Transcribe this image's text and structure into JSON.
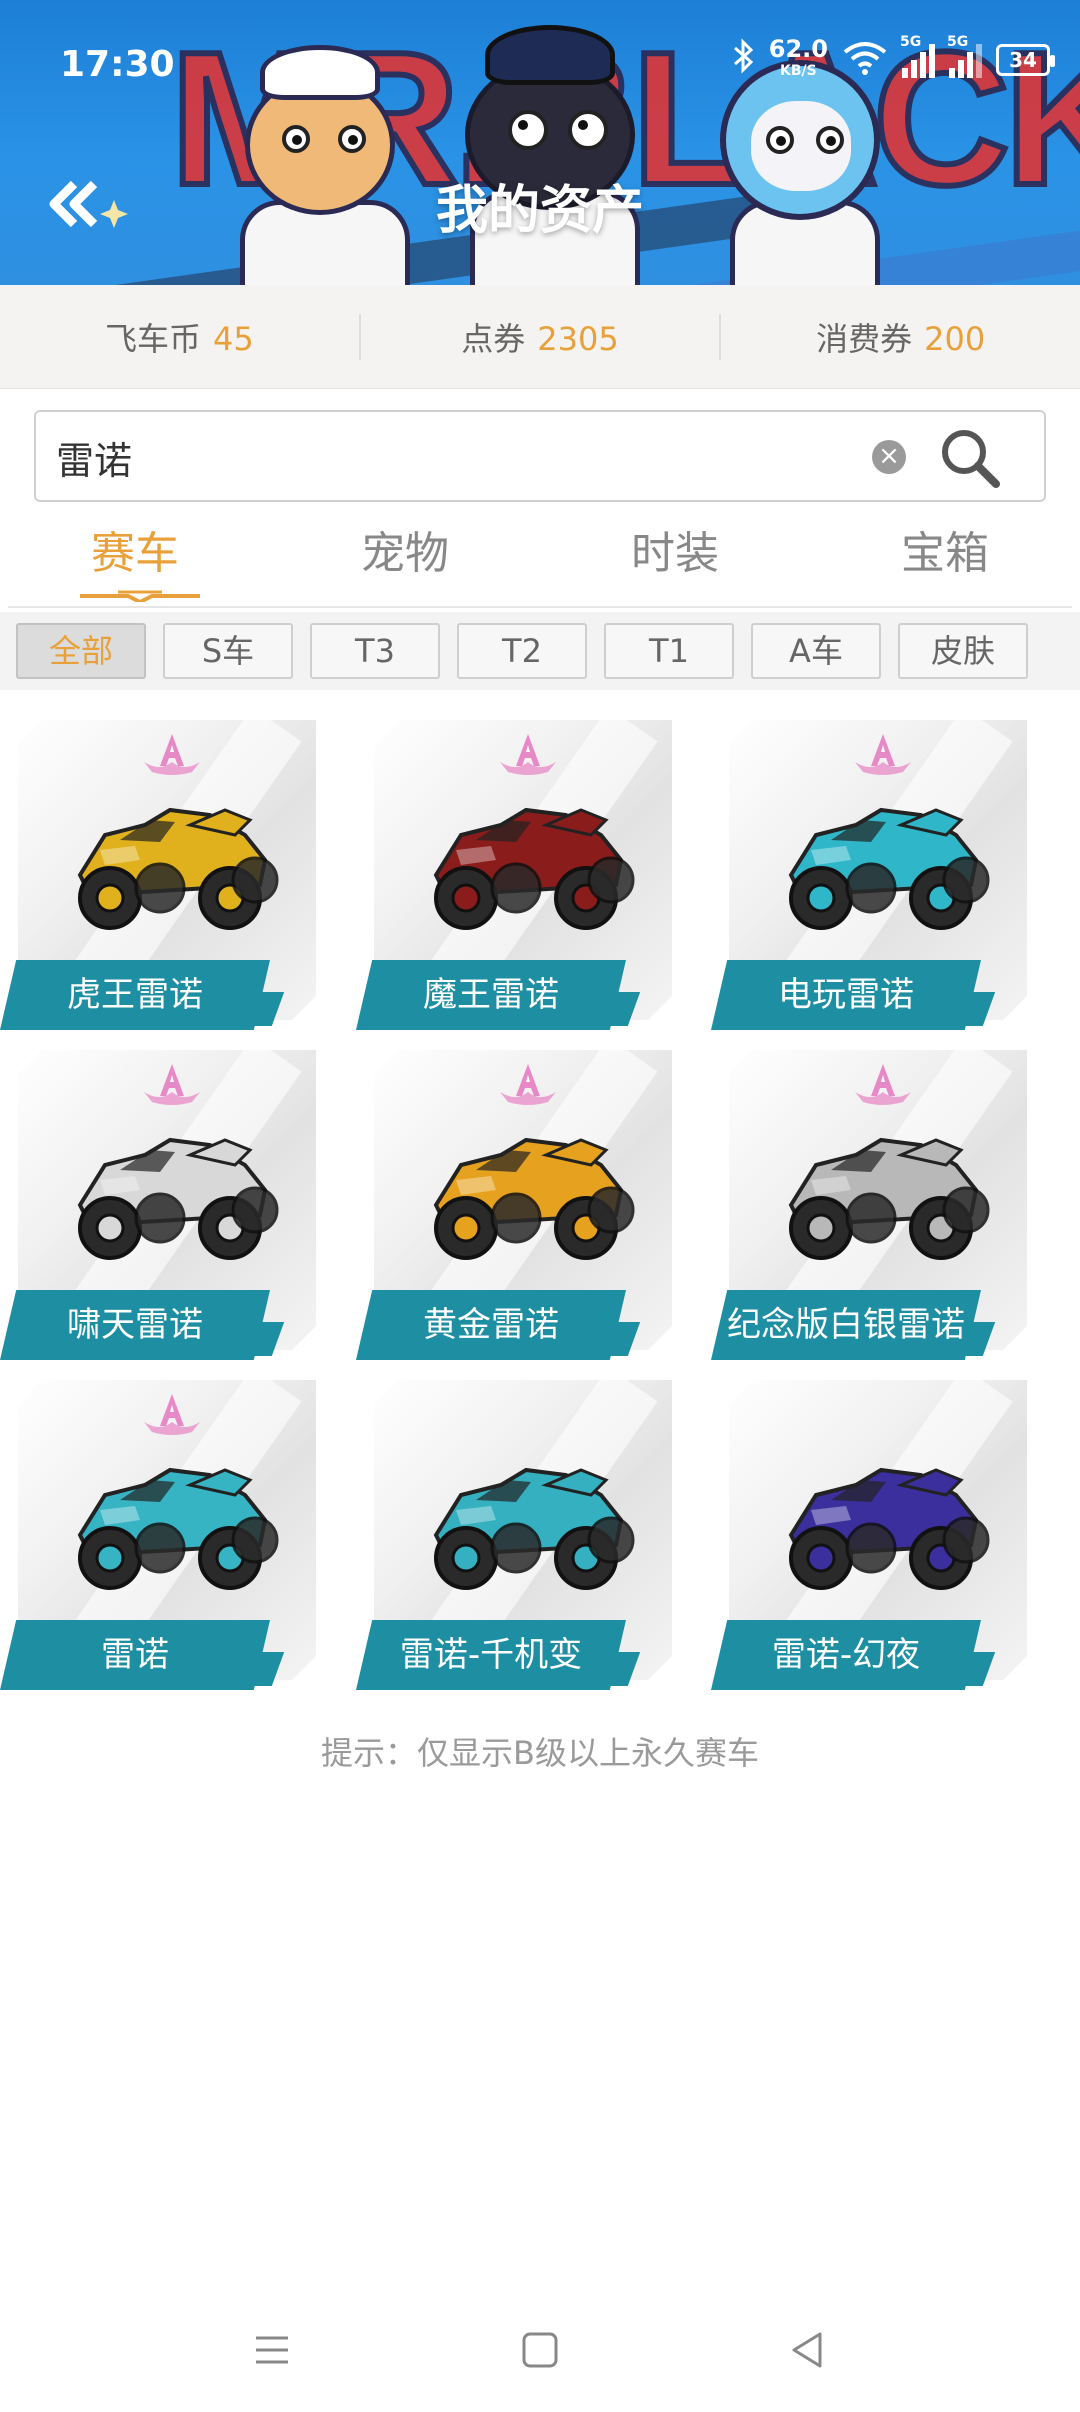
{
  "status_bar": {
    "time": "17:30",
    "net_speed": "62.0",
    "net_unit": "KB/S",
    "sim1": "5G",
    "sim2": "5G",
    "battery": "34",
    "icons": [
      "bluetooth-icon",
      "wifi-icon",
      "signal-icon",
      "battery-icon"
    ]
  },
  "header": {
    "title": "我的资产",
    "banner_text": "MR.BLACK"
  },
  "balance": [
    {
      "label": "飞车币",
      "value": "45"
    },
    {
      "label": "点券",
      "value": "2305"
    },
    {
      "label": "消费券",
      "value": "200"
    }
  ],
  "search": {
    "value": "雷诺",
    "placeholder": ""
  },
  "tabs": [
    {
      "label": "赛车",
      "active": true
    },
    {
      "label": "宠物",
      "active": false
    },
    {
      "label": "时装",
      "active": false
    },
    {
      "label": "宝箱",
      "active": false
    }
  ],
  "filters": [
    {
      "label": "全部",
      "active": true
    },
    {
      "label": "S车",
      "active": false
    },
    {
      "label": "T3",
      "active": false
    },
    {
      "label": "T2",
      "active": false
    },
    {
      "label": "T1",
      "active": false
    },
    {
      "label": "A车",
      "active": false
    },
    {
      "label": "皮肤",
      "active": false
    }
  ],
  "cars": [
    {
      "name": "虎王雷诺",
      "grade": "A",
      "color": "#e0b11c"
    },
    {
      "name": "魔王雷诺",
      "grade": "A",
      "color": "#8a1c1c"
    },
    {
      "name": "电玩雷诺",
      "grade": "A",
      "color": "#2fb7c9"
    },
    {
      "name": "啸天雷诺",
      "grade": "A",
      "color": "#d8d8d8"
    },
    {
      "name": "黄金雷诺",
      "grade": "A",
      "color": "#e6a21f"
    },
    {
      "name": "纪念版白银雷诺",
      "grade": "A",
      "color": "#b8b8b8"
    },
    {
      "name": "雷诺",
      "grade": "A",
      "color": "#37b4c4"
    },
    {
      "name": "雷诺-千机变",
      "grade": "",
      "color": "#35b0c0"
    },
    {
      "name": "雷诺-幻夜",
      "grade": "",
      "color": "#3b2f9e"
    }
  ],
  "hint": "提示：仅显示B级以上永久赛车",
  "colors": {
    "accent": "#e8a13a",
    "label_bg": "#1e8ea3",
    "header_bg": "#2a93e6",
    "badge": "#e889c7"
  }
}
